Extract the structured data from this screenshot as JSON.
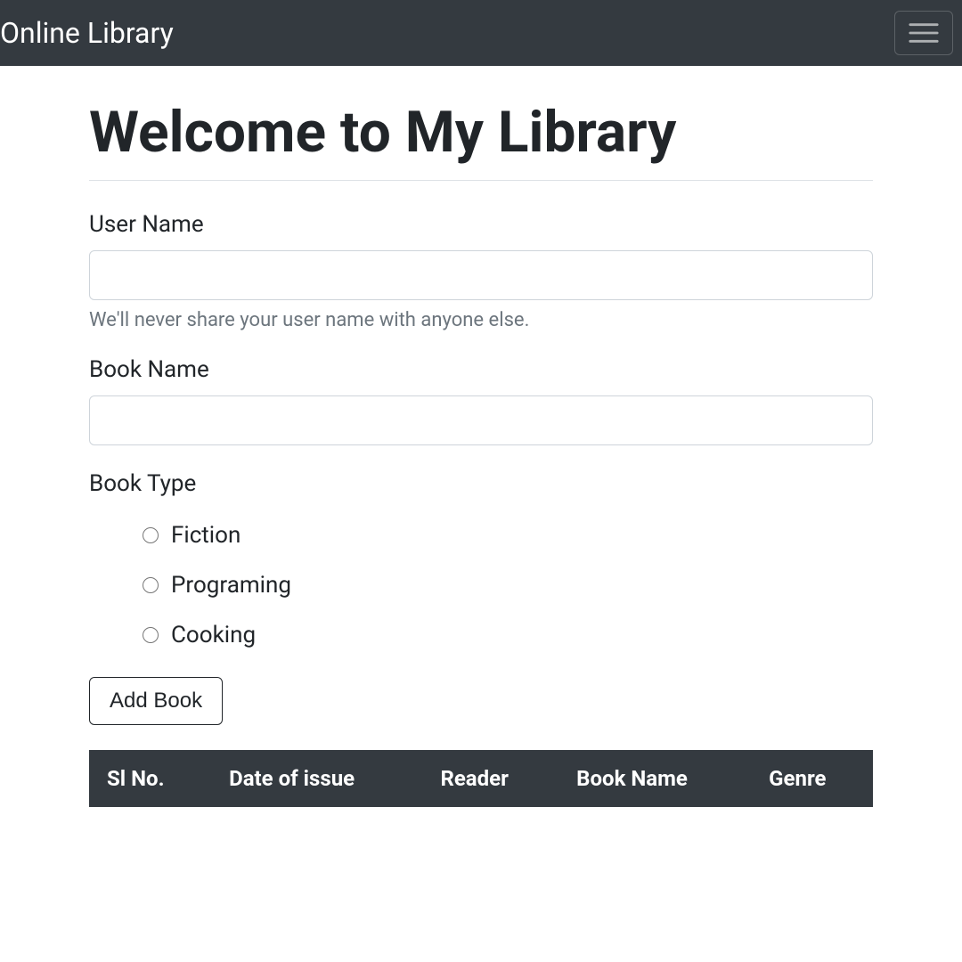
{
  "navbar": {
    "brand": "Online Library"
  },
  "page": {
    "title": "Welcome to My Library"
  },
  "form": {
    "user_name": {
      "label": "User Name",
      "value": "",
      "help": "We'll never share your user name with anyone else."
    },
    "book_name": {
      "label": "Book Name",
      "value": ""
    },
    "book_type": {
      "label": "Book Type",
      "options": [
        "Fiction",
        "Programing",
        "Cooking"
      ]
    },
    "submit_label": "Add Book"
  },
  "table": {
    "headers": [
      "Sl No.",
      "Date of issue",
      "Reader",
      "Book Name",
      "Genre"
    ]
  }
}
